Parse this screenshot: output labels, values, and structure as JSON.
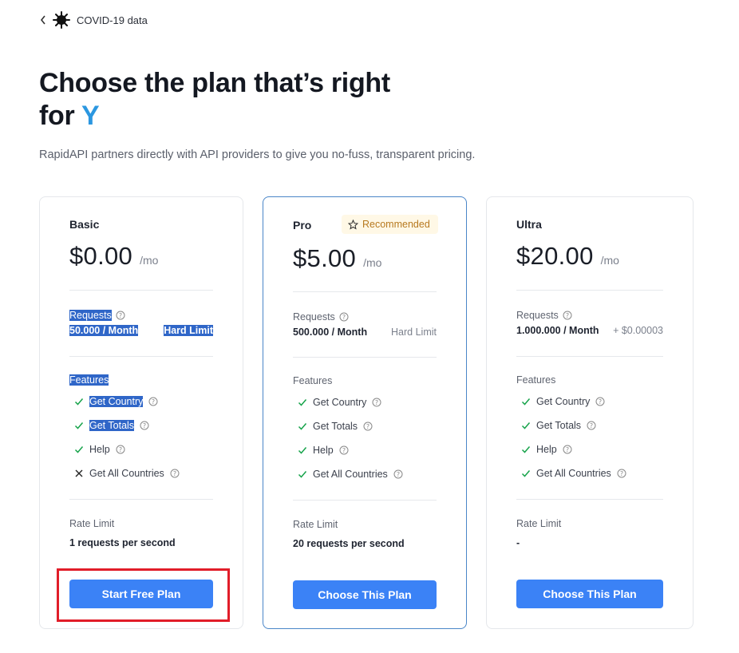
{
  "nav": {
    "back_label": "COVID-19 data"
  },
  "headline": {
    "line1": "Choose the plan that’s right",
    "line2_prefix": "for",
    "line2_accent": "Y"
  },
  "subtitle": "RapidAPI partners directly with API providers to give you no-fuss, transparent pricing.",
  "colors": {
    "accent": "#2b97e0",
    "button": "#3b82f6",
    "check": "#16a34a",
    "badge_bg": "#fff8e6",
    "badge_text": "#b7791f",
    "highlight": "#2f66c8",
    "annotation": "#e11d29"
  },
  "plans": {
    "basic": {
      "name": "Basic",
      "price": "$0.00",
      "per": "/mo",
      "requests_label": "Requests",
      "requests_qty": "50.000 / Month",
      "requests_limit": "Hard Limit",
      "features_label": "Features",
      "features": [
        {
          "label": "Get Country",
          "included": true
        },
        {
          "label": "Get Totals",
          "included": true
        },
        {
          "label": "Help",
          "included": true
        },
        {
          "label": "Get All Countries",
          "included": false
        }
      ],
      "rate_label": "Rate Limit",
      "rate_value": "1 requests per second",
      "button": "Start Free Plan"
    },
    "pro": {
      "name": "Pro",
      "badge": "Recommended",
      "price": "$5.00",
      "per": "/mo",
      "requests_label": "Requests",
      "requests_qty": "500.000 / Month",
      "requests_limit": "Hard Limit",
      "features_label": "Features",
      "features": [
        {
          "label": "Get Country",
          "included": true
        },
        {
          "label": "Get Totals",
          "included": true
        },
        {
          "label": "Help",
          "included": true
        },
        {
          "label": "Get All Countries",
          "included": true
        }
      ],
      "rate_label": "Rate Limit",
      "rate_value": "20 requests per second",
      "button": "Choose This Plan"
    },
    "ultra": {
      "name": "Ultra",
      "price": "$20.00",
      "per": "/mo",
      "requests_label": "Requests",
      "requests_qty": "1.000.000 / Month",
      "requests_limit": "+ $0.00003",
      "features_label": "Features",
      "features": [
        {
          "label": "Get Country",
          "included": true
        },
        {
          "label": "Get Totals",
          "included": true
        },
        {
          "label": "Help",
          "included": true
        },
        {
          "label": "Get All Countries",
          "included": true
        }
      ],
      "rate_label": "Rate Limit",
      "rate_value": "-",
      "button": "Choose This Plan"
    }
  }
}
